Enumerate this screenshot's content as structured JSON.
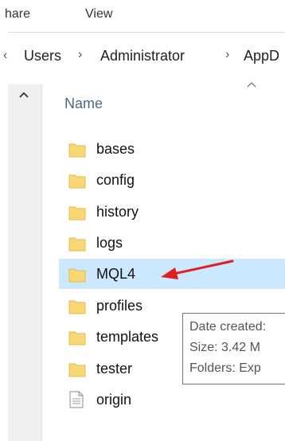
{
  "ribbon": {
    "tabs": [
      "hare",
      "View"
    ]
  },
  "address_bar": {
    "prefix_chevron": "‹",
    "crumbs": [
      "Users",
      "Administrator",
      "AppD"
    ],
    "separator": "›"
  },
  "columns": {
    "name": "Name"
  },
  "items": [
    {
      "name": "bases",
      "type": "folder"
    },
    {
      "name": "config",
      "type": "folder"
    },
    {
      "name": "history",
      "type": "folder"
    },
    {
      "name": "logs",
      "type": "folder"
    },
    {
      "name": "MQL4",
      "type": "folder",
      "selected": true
    },
    {
      "name": "profiles",
      "type": "folder"
    },
    {
      "name": "templates",
      "type": "folder"
    },
    {
      "name": "tester",
      "type": "folder"
    },
    {
      "name": "origin",
      "type": "file"
    }
  ],
  "tooltip": {
    "lines": [
      "Date created:",
      "Size: 3.42 M",
      "Folders: Exp"
    ]
  },
  "colors": {
    "folder": "#f8d775",
    "folder_dark": "#e8b94a",
    "selection": "#cce8ff",
    "annotation_arrow": "#e02020"
  },
  "icons": {
    "nav_scroll_up": "chevron-up-icon",
    "sort": "sort-ascending-icon",
    "folder": "folder-icon",
    "file": "file-icon"
  }
}
